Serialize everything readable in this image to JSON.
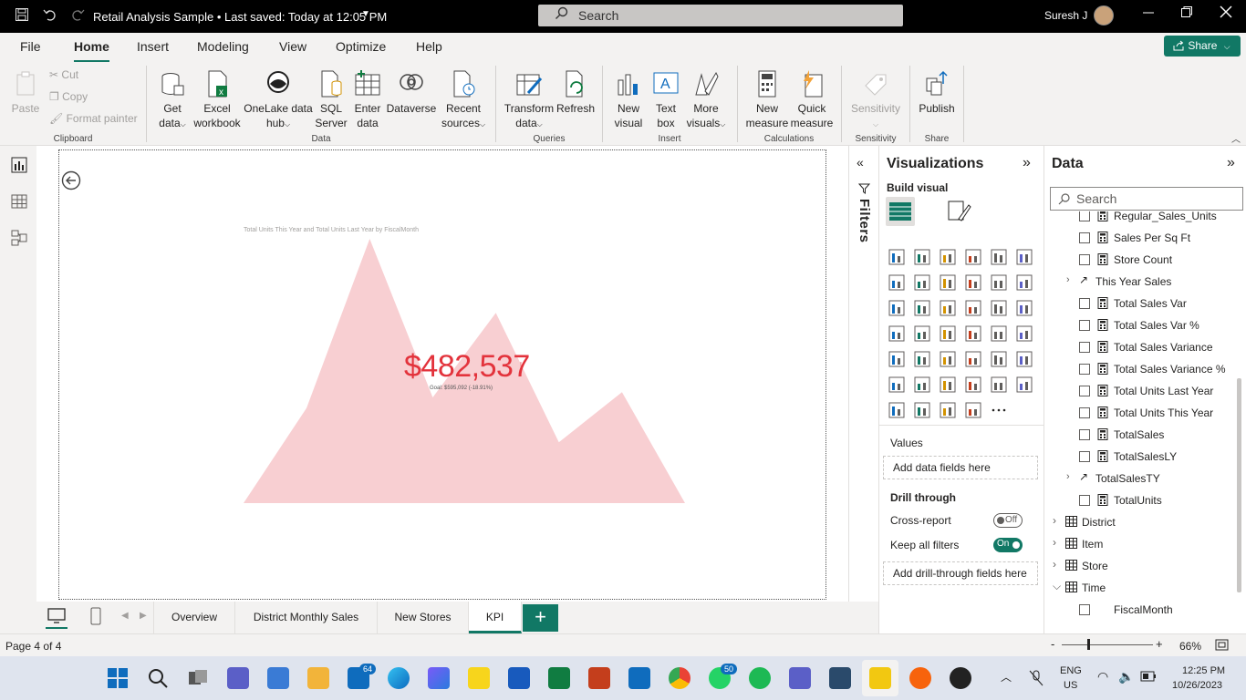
{
  "title_bar": {
    "document_title": "Retail Analysis Sample • Last saved: Today at 12:05 PM",
    "search_placeholder": "Search",
    "user_name": "Suresh J"
  },
  "menu": {
    "items": [
      "File",
      "Home",
      "Insert",
      "Modeling",
      "View",
      "Optimize",
      "Help"
    ],
    "active": "Home",
    "share_label": "Share"
  },
  "ribbon": {
    "clipboard": {
      "paste": "Paste",
      "cut": "Cut",
      "copy": "Copy",
      "format_painter": "Format painter",
      "label": "Clipboard"
    },
    "data": {
      "get_data": [
        "Get",
        "data"
      ],
      "excel": [
        "Excel",
        "workbook"
      ],
      "onelake": [
        "OneLake data",
        "hub"
      ],
      "sql": [
        "SQL",
        "Server"
      ],
      "enter": [
        "Enter",
        "data"
      ],
      "dataverse": "Dataverse",
      "recent": [
        "Recent",
        "sources"
      ],
      "label": "Data"
    },
    "queries": {
      "transform": [
        "Transform",
        "data"
      ],
      "refresh": "Refresh",
      "label": "Queries"
    },
    "insert": {
      "new_visual": [
        "New",
        "visual"
      ],
      "text_box": [
        "Text",
        "box"
      ],
      "more_visuals": [
        "More",
        "visuals"
      ],
      "label": "Insert"
    },
    "calculations": {
      "new_measure": [
        "New",
        "measure"
      ],
      "quick_measure": [
        "Quick",
        "measure"
      ],
      "label": "Calculations"
    },
    "sensitivity": {
      "button": "Sensitivity",
      "label": "Sensitivity"
    },
    "share": {
      "publish": "Publish",
      "label": "Share"
    }
  },
  "report": {
    "chart_title": "Total Units This Year and Total Units Last Year by FiscalMonth",
    "kpi_value": "$482,537",
    "kpi_indicator": "!",
    "kpi_goal": "Goal: $595,092 (-18.91%)"
  },
  "chart_data": {
    "type": "area",
    "title": "Total Units This Year and Total Units Last Year by FiscalMonth",
    "x": [
      1,
      2,
      3,
      4,
      5,
      6,
      7,
      8
    ],
    "series": [
      {
        "values": [
          0,
          36,
          100,
          40,
          72,
          23,
          42,
          0
        ]
      }
    ],
    "area_color": "#f8cfd2",
    "kpi": {
      "value": "$482,537",
      "goal": "$595,092",
      "variance": "-18.91%",
      "status_color": "#e3333c"
    }
  },
  "filters_pane": {
    "label": "Filters"
  },
  "visualizations_pane": {
    "title": "Visualizations",
    "build_visual": "Build visual",
    "values_label": "Values",
    "values_drop": "Add data fields here",
    "drill_through": "Drill through",
    "cross_report": "Cross-report",
    "cross_report_state": "Off",
    "keep_filters": "Keep all filters",
    "keep_filters_state": "On",
    "drill_drop": "Add drill-through fields here"
  },
  "data_pane": {
    "title": "Data",
    "search_placeholder": "Search",
    "fields": [
      {
        "name": "Regular_Sales_Units",
        "kind": "measure"
      },
      {
        "name": "Sales Per Sq Ft",
        "kind": "measure"
      },
      {
        "name": "Store Count",
        "kind": "measure"
      },
      {
        "name": "This Year Sales",
        "kind": "kpi"
      },
      {
        "name": "Total Sales Var",
        "kind": "measure"
      },
      {
        "name": "Total Sales Var %",
        "kind": "measure"
      },
      {
        "name": "Total Sales Variance",
        "kind": "measure"
      },
      {
        "name": "Total Sales Variance %",
        "kind": "measure"
      },
      {
        "name": "Total Units Last Year",
        "kind": "measure"
      },
      {
        "name": "Total Units This Year",
        "kind": "measure"
      },
      {
        "name": "TotalSales",
        "kind": "measure"
      },
      {
        "name": "TotalSalesLY",
        "kind": "measure"
      },
      {
        "name": "TotalSalesTY",
        "kind": "kpi"
      },
      {
        "name": "TotalUnits",
        "kind": "measure"
      }
    ],
    "tables": [
      "District",
      "Item",
      "Store",
      "Time"
    ],
    "time_field": "FiscalMonth"
  },
  "page_tabs": [
    "Overview",
    "District Monthly Sales",
    "New Stores",
    "KPI"
  ],
  "active_tab": "KPI",
  "add_tab": "+",
  "status": {
    "page": "Page 4 of 4",
    "zoom": "66%",
    "zoom_minus": "-",
    "zoom_plus": "+"
  },
  "taskbar": {
    "mail_badge": "64",
    "whatsapp_badge": "50",
    "lang": "ENG",
    "region": "US",
    "time": "12:25 PM",
    "date": "10/26/2023"
  }
}
